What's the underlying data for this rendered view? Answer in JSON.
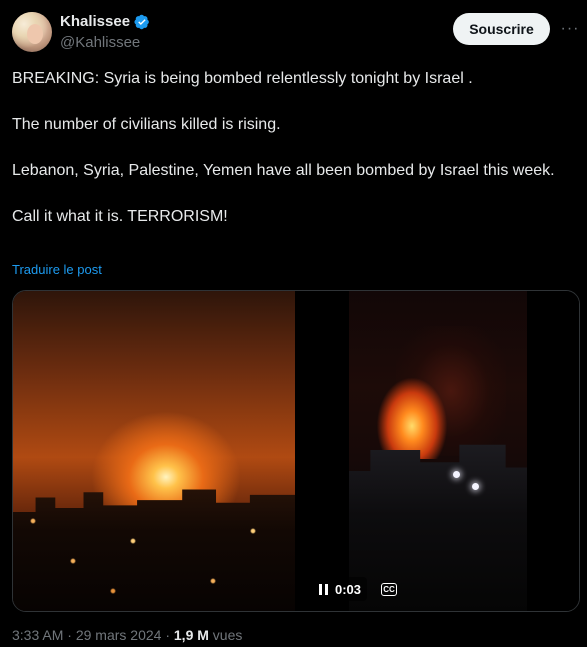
{
  "author": {
    "display_name": "Khalissee",
    "handle": "@Kahlissee",
    "verified": true
  },
  "actions": {
    "subscribe_label": "Souscrire",
    "more_icon": "more-dots-icon"
  },
  "tweet": {
    "paragraphs": [
      "BREAKING: Syria is being bombed relentlessly tonight by Israel .",
      "The number of civilians killed is rising.",
      "Lebanon, Syria, Palestine, Yemen have all been bombed by Israel this week.",
      "Call it what it is. TERRORISM!"
    ],
    "translate_label": "Traduire le post"
  },
  "media": {
    "video_time": "0:03",
    "cc_label": "CC"
  },
  "meta": {
    "time": "3:33 AM",
    "date": "29 mars 2024",
    "views_count": "1,9 M",
    "views_label": "vues"
  },
  "colors": {
    "background": "#000000",
    "text": "#e7e9ea",
    "secondary": "#71767b",
    "link": "#1d9bf0",
    "verified": "#1d9bf0"
  }
}
